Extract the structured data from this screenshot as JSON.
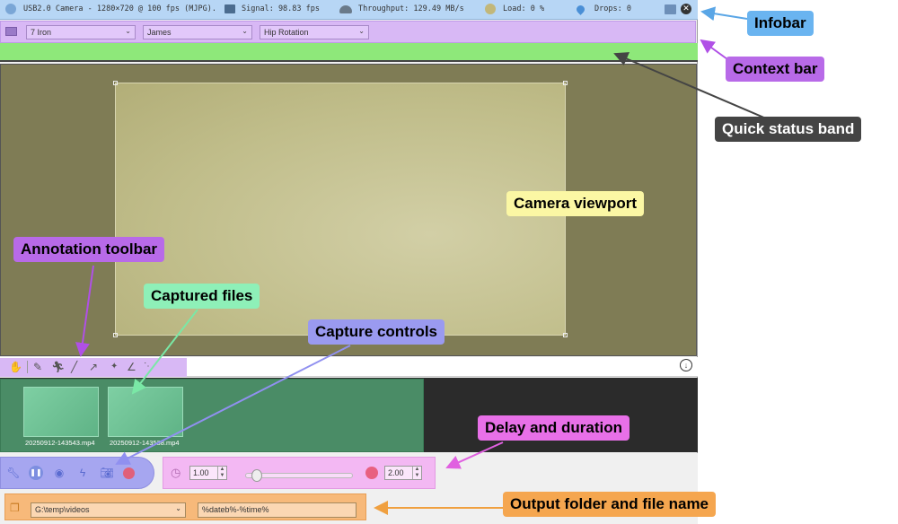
{
  "infobar": {
    "camera": "USB2.0 Camera - 1280×720 @ 100 fps (MJPG).",
    "signal": "Signal: 98.83 fps",
    "throughput": "Throughput: 129.49 MB/s",
    "load": "Load:    0 %",
    "drops": "Drops: 0"
  },
  "context_bar": {
    "club": "7 Iron",
    "player": "James",
    "movement": "Hip Rotation"
  },
  "captured_files": [
    {
      "name": "20250912-143543.mp4"
    },
    {
      "name": "20250912-143538.mp4"
    }
  ],
  "delay": {
    "value": "1.00"
  },
  "duration": {
    "value": "2.00"
  },
  "output": {
    "folder": "G:\\temp\\videos",
    "filename": "%dateb%-%time%"
  },
  "callouts": {
    "infobar": "Infobar",
    "context_bar": "Context bar",
    "quick_status": "Quick status band",
    "camera_viewport": "Camera viewport",
    "annotation_toolbar": "Annotation toolbar",
    "captured_files": "Captured files",
    "capture_controls": "Capture controls",
    "delay_duration": "Delay and duration",
    "output": "Output folder and file name"
  },
  "colors": {
    "infobar": "#b7d6f5",
    "context_bar": "#d8b8f5",
    "quick_status": "#8ee87a",
    "captured_files": "#4a8c66",
    "capture_controls": "#a6a6f0",
    "delay_duration": "#f3b8f3",
    "output": "#f7b97a"
  },
  "icons": [
    "settings-icon",
    "signal-icon",
    "throughput-icon",
    "load-icon",
    "drops-icon",
    "fullscreen-icon",
    "close-icon",
    "hand-icon",
    "pencil-icon",
    "running-icon",
    "line-icon",
    "arrow-icon",
    "point-icon",
    "angle-icon",
    "download-icon",
    "wrench-icon",
    "pause-icon",
    "record-target-icon",
    "lightning-icon",
    "camera-icon",
    "stop-record-icon",
    "clock-icon",
    "duration-icon",
    "folder-icon"
  ]
}
